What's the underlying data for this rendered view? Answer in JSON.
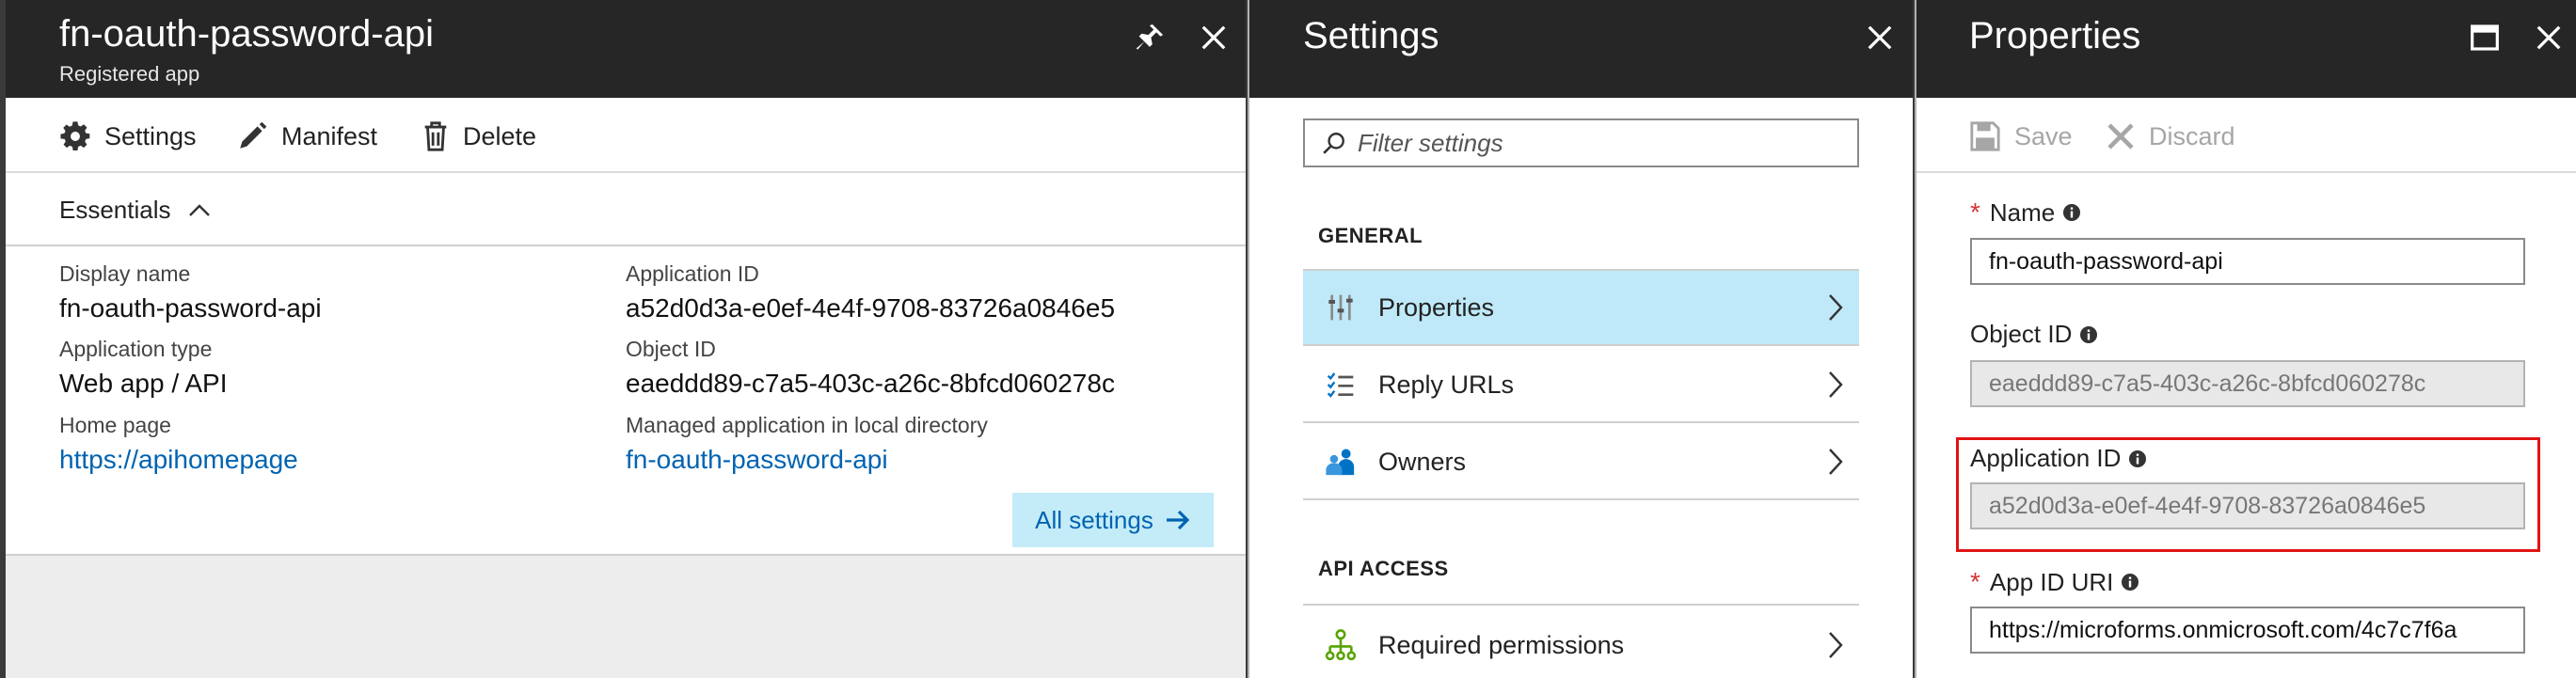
{
  "registered_app_blade": {
    "title": "fn-oauth-password-api",
    "subtitle": "Registered app",
    "toolbar": {
      "settings": "Settings",
      "manifest": "Manifest",
      "delete": "Delete"
    },
    "essentials": {
      "label": "Essentials",
      "display_name_label": "Display name",
      "display_name_value": "fn-oauth-password-api",
      "application_type_label": "Application type",
      "application_type_value": "Web app / API",
      "home_page_label": "Home page",
      "home_page_value": "https://apihomepage",
      "application_id_label": "Application ID",
      "application_id_value": "a52d0d3a-e0ef-4e4f-9708-83726a0846e5",
      "object_id_label": "Object ID",
      "object_id_value": "eaeddd89-c7a5-403c-a26c-8bfcd060278c",
      "managed_app_label": "Managed application in local directory",
      "managed_app_value": "fn-oauth-password-api"
    },
    "all_settings": "All settings"
  },
  "settings_blade": {
    "title": "Settings",
    "filter_placeholder": "Filter settings",
    "general_header": "GENERAL",
    "general_items": [
      {
        "label": "Properties",
        "icon": "properties-sliders-icon",
        "selected": true
      },
      {
        "label": "Reply URLs",
        "icon": "checklist-icon",
        "selected": false
      },
      {
        "label": "Owners",
        "icon": "users-icon",
        "selected": false
      }
    ],
    "api_access_header": "API ACCESS",
    "api_access_items": [
      {
        "label": "Required permissions",
        "icon": "hierarchy-icon"
      }
    ]
  },
  "properties_blade": {
    "title": "Properties",
    "toolbar": {
      "save": "Save",
      "discard": "Discard"
    },
    "name_label": "Name",
    "name_value": "fn-oauth-password-api",
    "object_id_label": "Object ID",
    "object_id_value": "eaeddd89-c7a5-403c-a26c-8bfcd060278c",
    "application_id_label": "Application ID",
    "application_id_value": "a52d0d3a-e0ef-4e4f-9708-83726a0846e5",
    "app_id_uri_label": "App ID URI",
    "app_id_uri_value": "https://microforms.onmicrosoft.com/4c7c7f6a"
  },
  "colors": {
    "header_bg": "#262626",
    "link": "#0063b1",
    "selected_bg": "#bfe9f8",
    "required": "#d13438",
    "highlight": "#e01414"
  }
}
